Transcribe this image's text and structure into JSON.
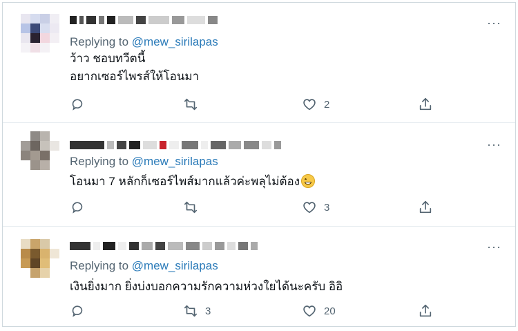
{
  "tweets": [
    {
      "reply_prefix": "Replying to ",
      "reply_handle": "@mew_sirilapas",
      "lines": [
        "ว้าว ชอบทวีตนี้",
        "อยากเซอร์ไพรส์ให้โอนมา"
      ],
      "like_count": "2",
      "retweet_count": "",
      "more_label": "···"
    },
    {
      "reply_prefix": "Replying to ",
      "reply_handle": "@mew_sirilapas",
      "lines": [
        "โอนมา 7 หลักก็เซอร์ไพส์มากแล้วค่ะพลุไม่ต้อง"
      ],
      "like_count": "3",
      "retweet_count": "",
      "more_label": "···"
    },
    {
      "reply_prefix": "Replying to ",
      "reply_handle": "@mew_sirilapas",
      "lines": [
        "เงินยิ่งมาก ยิ่งบ่งบอกความรักความห่วงใยได้นะครับ อิอิ"
      ],
      "like_count": "20",
      "retweet_count": "3",
      "more_label": "···"
    }
  ],
  "icons": [
    "reply-icon",
    "retweet-icon",
    "like-icon",
    "share-icon",
    "more-icon"
  ],
  "colors": {
    "handle": "#2b7bb9",
    "muted": "#536471",
    "text": "#0f1419",
    "divider": "#e6ecf0"
  }
}
